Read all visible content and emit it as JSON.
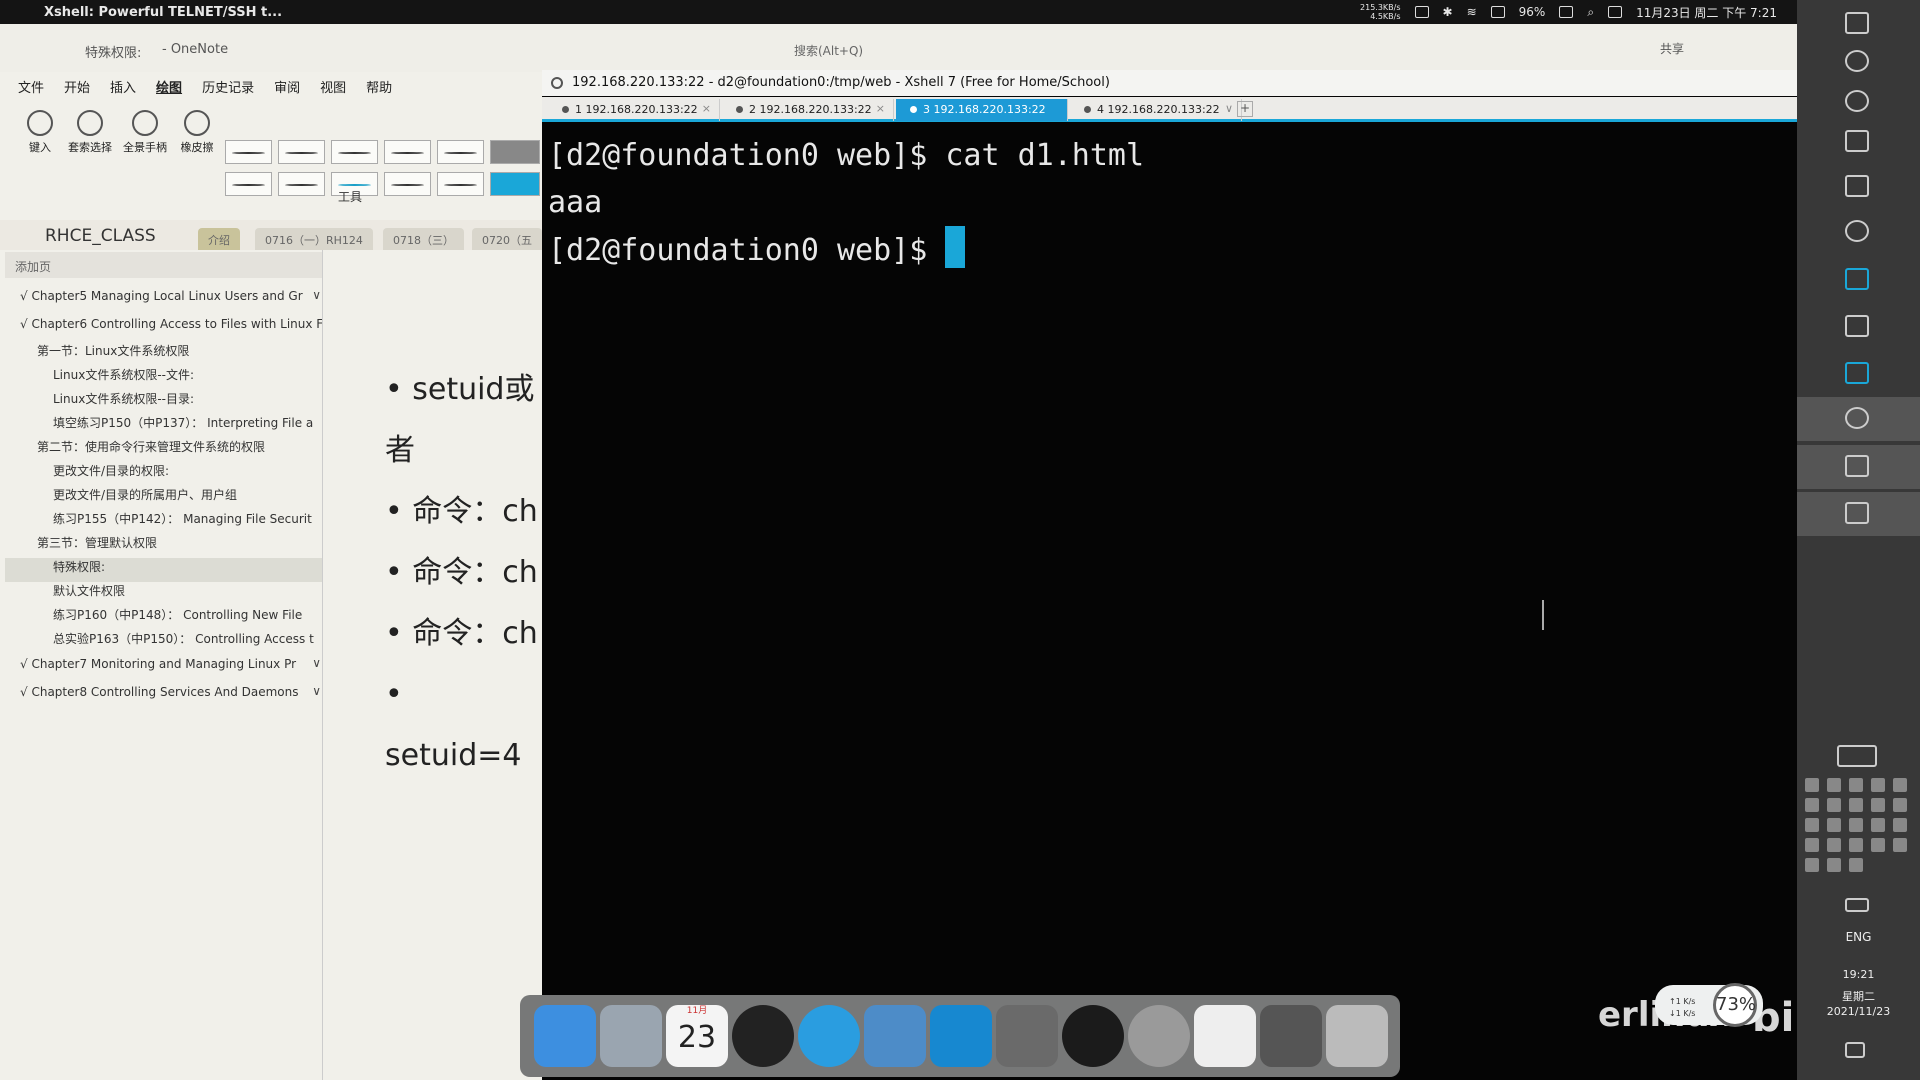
{
  "menubar": {
    "app_title": "Xshell: Powerful TELNET/SSH t...",
    "net_up": "215.3KB/s",
    "net_down": "4.5KB/s",
    "battery": "96%",
    "clock": "11月23日 周二 下午 7:21"
  },
  "onenote": {
    "window_title": "特殊权限:",
    "app_name": "- OneNote",
    "search_placeholder": "搜索(Alt+Q)",
    "share_label": "共享",
    "menu": [
      "文件",
      "开始",
      "插入",
      "绘图",
      "历史记录",
      "审阅",
      "视图",
      "帮助"
    ],
    "tools": {
      "type": "键入",
      "lasso": "套索选择",
      "pan": "全景手柄",
      "eraser": "橡皮擦",
      "group_label": "工具"
    },
    "notebook_name": "RHCE_CLASS",
    "section_tabs": [
      "介绍",
      "0716（一）RH124",
      "0718（三）",
      "0720（五"
    ],
    "add_page": "添加页",
    "pages": [
      {
        "text": "√ Chapter5 Managing Local Linux Users and Gr",
        "level": 1
      },
      {
        "text": "√ Chapter6 Controlling Access to Files with Linux F",
        "level": 1
      },
      {
        "text": "第一节：Linux文件系统权限",
        "level": 2
      },
      {
        "text": "Linux文件系统权限--文件:",
        "level": 3
      },
      {
        "text": "Linux文件系统权限--目录:",
        "level": 3
      },
      {
        "text": "填空练习P150（中P137）：  Interpreting File a",
        "level": 3
      },
      {
        "text": "第二节：使用命令行来管理文件系统的权限",
        "level": 2
      },
      {
        "text": "更改文件/目录的权限:",
        "level": 3
      },
      {
        "text": "更改文件/目录的所属用户、用户组",
        "level": 3
      },
      {
        "text": "练习P155（中P142）：  Managing File Securit",
        "level": 3
      },
      {
        "text": "第三节：管理默认权限",
        "level": 2
      },
      {
        "text": "特殊权限:",
        "level": 3
      },
      {
        "text": "默认文件权限",
        "level": 3
      },
      {
        "text": "练习P160（中P148）：  Controlling New File",
        "level": 3
      },
      {
        "text": "总实验P163（中P150）：  Controlling Access t",
        "level": 3
      },
      {
        "text": "√ Chapter7 Monitoring and Managing Linux Pr",
        "level": 1
      },
      {
        "text": "√ Chapter8 Controlling Services And Daemons",
        "level": 1
      }
    ],
    "content": [
      "• setuid或",
      "者",
      "• 命令：ch",
      "• 命令：ch",
      "• 命令：ch",
      "• setuid=4"
    ]
  },
  "xshell": {
    "title": "192.168.220.133:22 - d2@foundation0:/tmp/web - Xshell 7 (Free for Home/School)",
    "tabs": [
      {
        "label": "1 192.168.220.133:22"
      },
      {
        "label": "2 192.168.220.133:22"
      },
      {
        "label": "3 192.168.220.133:22"
      },
      {
        "label": "4 192.168.220.133:22"
      }
    ],
    "terminal": [
      "[d2@foundation0 web]$ cat d1.html",
      "aaa",
      "[d2@foundation0 web]$ "
    ]
  },
  "dock": {
    "month": "11月",
    "day": "23"
  },
  "right_bar": {
    "lang": "ENG",
    "time": "19:21",
    "weekday": "星期二",
    "date": "2021/11/23"
  },
  "monitor": {
    "up": "↑1 K/s",
    "down": "↓1 K/s",
    "cpu": "73%"
  },
  "watermark": {
    "left": "erlinux",
    "right": "bilibili"
  },
  "colors": {
    "accent": "#1aa7d8",
    "terminal_bg": "#050505"
  }
}
